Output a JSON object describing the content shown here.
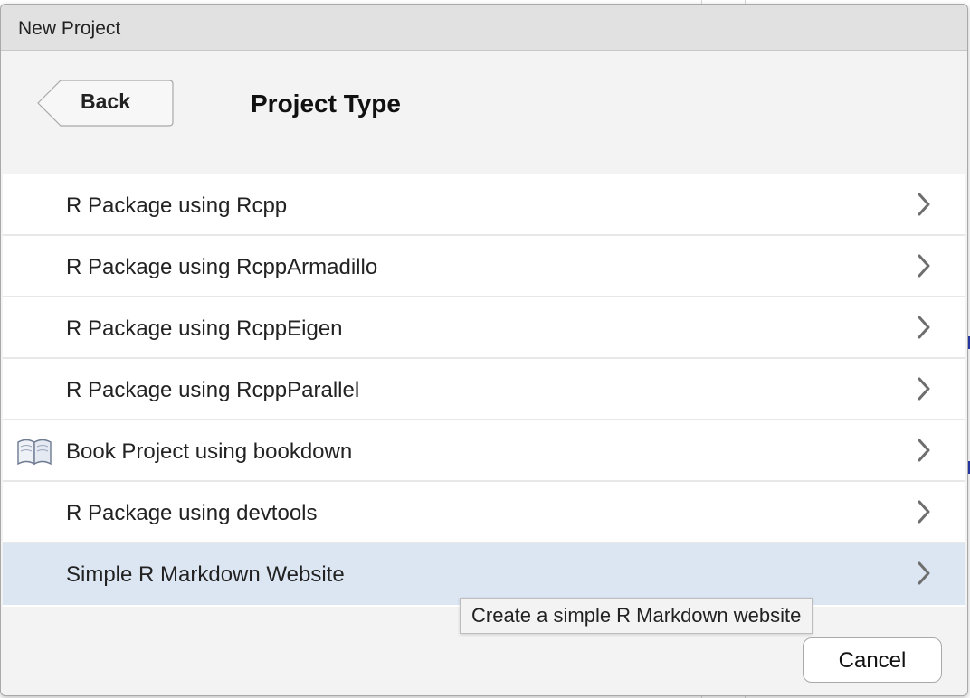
{
  "window": {
    "title": "New Project"
  },
  "header": {
    "back_label": "Back",
    "heading": "Project Type"
  },
  "project_types": [
    {
      "label": "R Package using Rcpp",
      "icon": null,
      "selected": false
    },
    {
      "label": "R Package using RcppArmadillo",
      "icon": null,
      "selected": false
    },
    {
      "label": "R Package using RcppEigen",
      "icon": null,
      "selected": false
    },
    {
      "label": "R Package using RcppParallel",
      "icon": null,
      "selected": false
    },
    {
      "label": "Book Project using bookdown",
      "icon": "book-icon",
      "selected": false
    },
    {
      "label": "R Package using devtools",
      "icon": null,
      "selected": false
    },
    {
      "label": "Simple R Markdown Website",
      "icon": null,
      "selected": true
    }
  ],
  "tooltip": {
    "text": "Create a simple R Markdown website"
  },
  "footer": {
    "cancel_label": "Cancel"
  },
  "colors": {
    "selected_row": "#dce6f2",
    "dialog_bg": "#f3f3f3",
    "titlebar_bg": "#e1e1e1"
  }
}
